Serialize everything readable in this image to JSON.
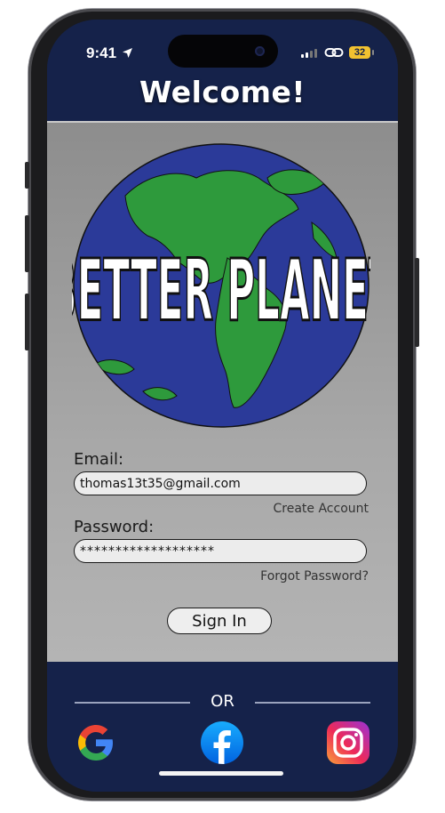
{
  "status_bar": {
    "time": "9:41",
    "battery": "32"
  },
  "header": {
    "title": "Welcome!"
  },
  "logo": {
    "text": "BETTER PLANET"
  },
  "form": {
    "email_label": "Email:",
    "email_value": "thomas13t35@gmail.com",
    "create_account": "Create Account",
    "password_label": "Password:",
    "password_value": "*******************",
    "forgot_password": "Forgot Password?",
    "sign_in": "Sign In"
  },
  "alt_login": {
    "or_text": "OR",
    "providers": [
      "google-icon",
      "facebook-icon",
      "instagram-icon"
    ]
  },
  "colors": {
    "navy": "#15224a",
    "globe_ocean": "#2a3a9a",
    "land": "#2a9a3a"
  }
}
